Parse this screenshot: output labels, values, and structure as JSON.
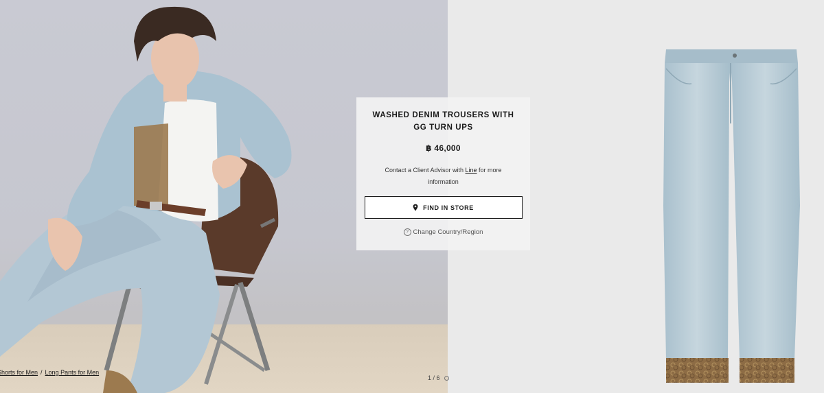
{
  "product": {
    "title": "WASHED DENIM TROUSERS WITH GG TURN UPS",
    "price": "฿ 46,000",
    "advisor_prefix": "Contact a Client Advisor with ",
    "advisor_link": "Line",
    "advisor_suffix": " for more information",
    "find_in_store_label": "FIND IN STORE",
    "find_in_store_icon": "location-pin-icon",
    "change_region_label": "Change Country/Region",
    "change_region_icon": "help-circle-icon"
  },
  "breadcrumb": {
    "items": [
      "Shorts for Men",
      "Long Pants for Men"
    ],
    "separator": "/"
  },
  "gallery": {
    "pager_text": "1 / 6"
  },
  "colors": {
    "card_bg": "#f2f2f2",
    "denim_light": "#b8ccd6",
    "denim_mid": "#a3bccb",
    "gg_canvas": "#9c7a4f",
    "text": "#1b1b1b"
  }
}
